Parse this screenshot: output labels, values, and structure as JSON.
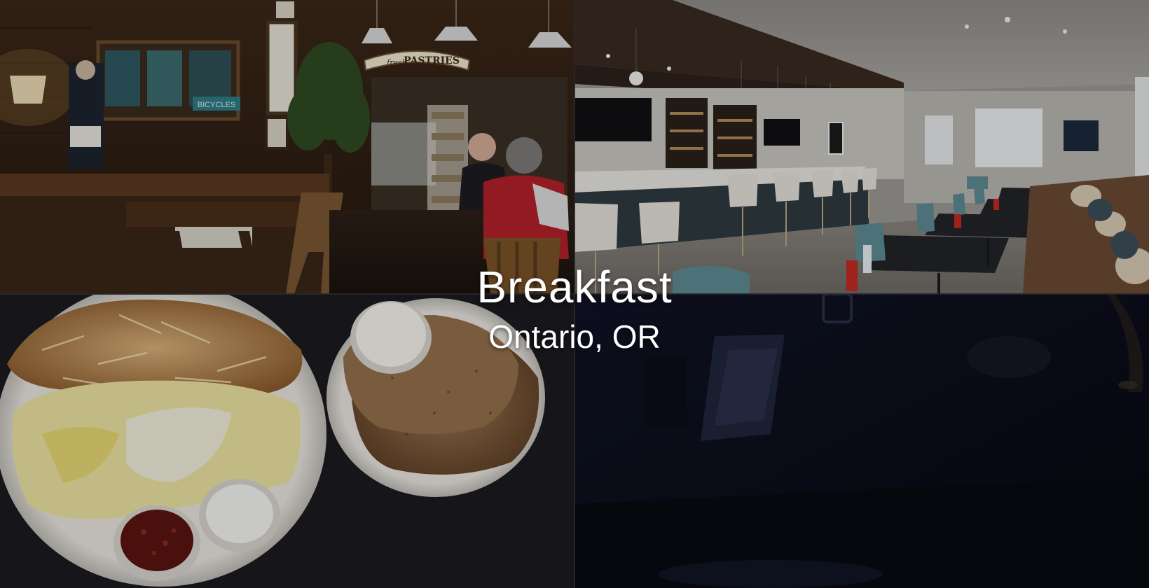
{
  "hero": {
    "title": "Breakfast",
    "subtitle": "Ontario, OR"
  },
  "photos": [
    {
      "name": "cafe-interior-photo",
      "sign_text": "PASTRIES",
      "sign_script": "fresh",
      "sign_bicycles": "BICYCLES"
    },
    {
      "name": "restaurant-bar-photo"
    },
    {
      "name": "breakfast-plate-photo"
    },
    {
      "name": "dark-dining-photo"
    }
  ],
  "colors": {
    "title_text": "#ffffff",
    "wood_warm": "#5a3a22",
    "bar_white": "#d8d6d2",
    "table_dark": "#1f1f24",
    "night_blue": "#0d0f1c"
  }
}
